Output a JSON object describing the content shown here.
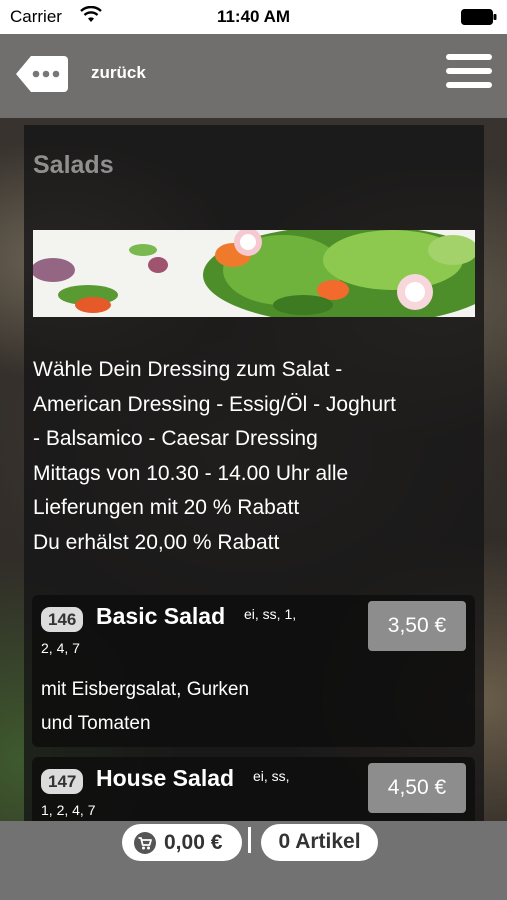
{
  "status_bar": {
    "carrier": "Carrier",
    "time": "11:40 AM"
  },
  "nav": {
    "back_label": "zurück",
    "back_icon": "back-tag-icon",
    "menu_icon": "hamburger-icon"
  },
  "category": {
    "title": "Salads",
    "description_lines": [
      "Wähle Dein Dressing zum Salat -",
      "American Dressing - Essig/Öl - Joghurt",
      "- Balsamico - Caesar Dressing",
      "Mittags von 10.30 - 14.00 Uhr alle",
      "Lieferungen mit 20 % Rabatt",
      "Du erhälst 20,00 % Rabatt"
    ]
  },
  "items": [
    {
      "number": "146",
      "name": "Basic Salad",
      "allergens_line1": "ei, ss, 1,",
      "allergens_line2": "2, 4, 7",
      "price": "3,50 €",
      "description_lines": [
        "mit Eisbergsalat, Gurken",
        "und Tomaten"
      ]
    },
    {
      "number": "147",
      "name": "House Salad",
      "allergens_line1": "ei, ss,",
      "allergens_line2": "1, 2, 4, 7",
      "price": "4,50 €"
    }
  ],
  "cart": {
    "amount": "0,00 €",
    "count_label": "0 Artikel",
    "icon": "cart-icon"
  },
  "colors": {
    "nav_bg": "#787878",
    "price_button": "#8d8d8d",
    "bottom_bar": "#727272"
  }
}
